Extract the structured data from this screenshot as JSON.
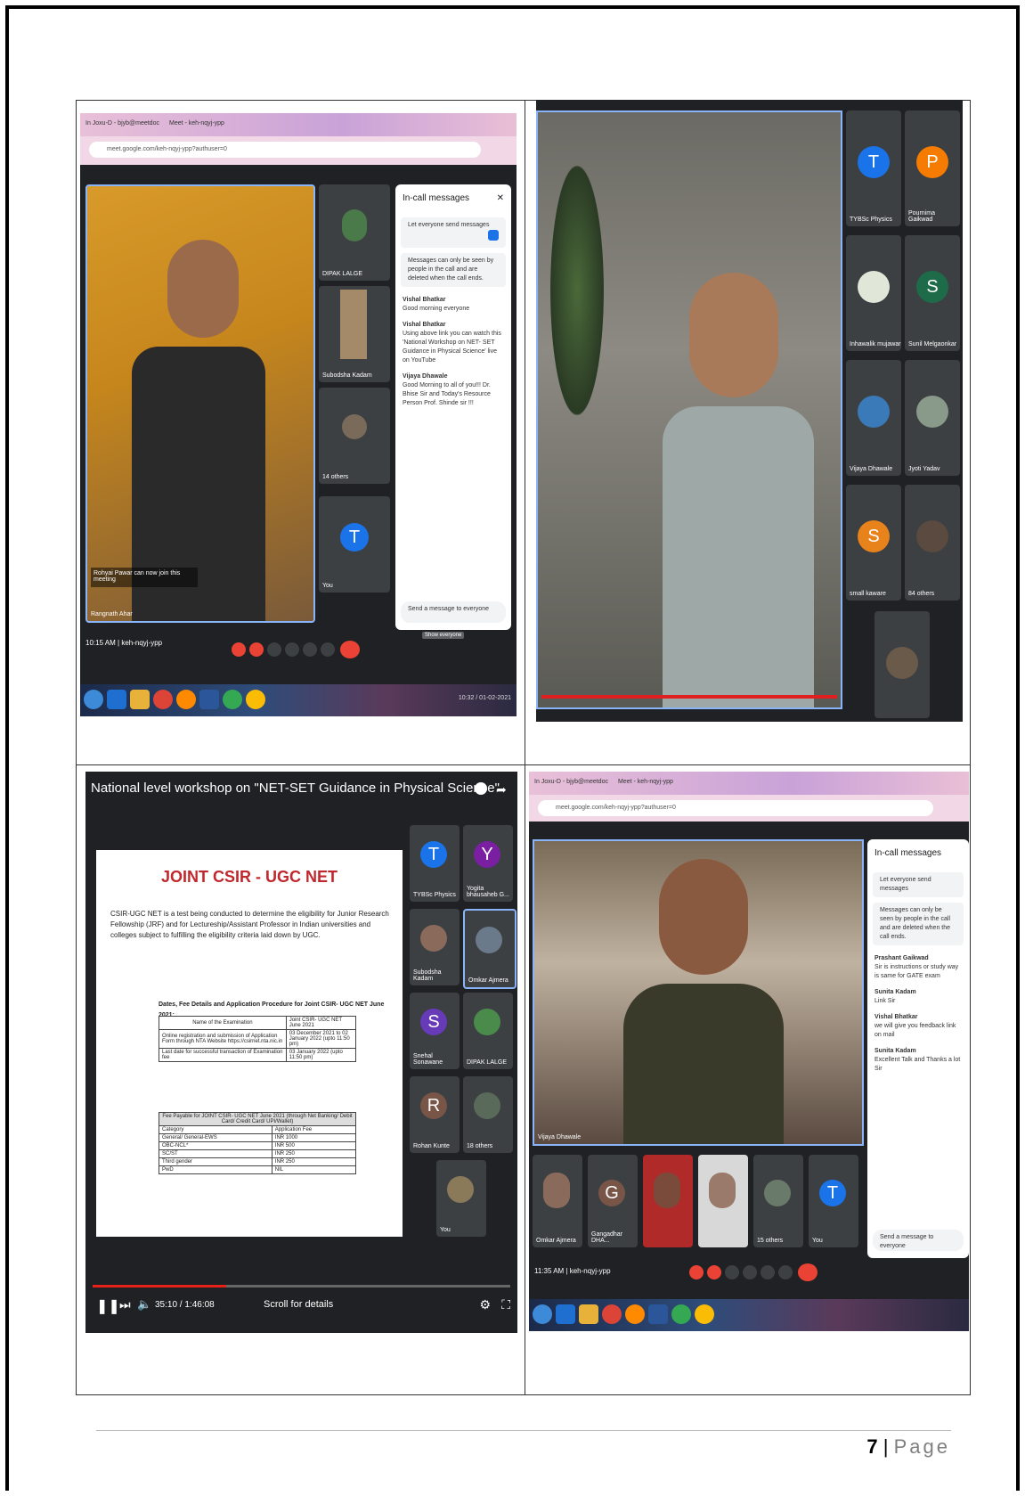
{
  "page": {
    "number": "7",
    "suffix": "Page"
  },
  "panel_tl": {
    "tabs": [
      "In Joxu-D - bjyb@meetdoc",
      "Meet - keh-nqyj-ypp"
    ],
    "url": "meet.google.com/keh-nqyj-ypp?authuser=0",
    "chat_title": "In-call messages",
    "chat_toggle": "Let everyone send messages",
    "chat_note": "Messages can only be seen by people in the call and are deleted when the call ends.",
    "messages": [
      {
        "from": "Vishal Bhatkar",
        "text": "Good morning everyone"
      },
      {
        "from": "Vishal Bhatkar",
        "text": "Using above link you can watch this 'National Workshop on NET- SET Guidance in Physical Science' live on YouTube"
      },
      {
        "from": "Vijaya Dhawale",
        "text": "Good Morning to all of you!!! Dr. Bhise Sir and Today's Resource Person Prof. Shinde sir !!!"
      }
    ],
    "chat_input": "Send a message to everyone",
    "tiles": [
      "DIPAK LALGE",
      "Subodsha Kadam",
      "14 others",
      "You"
    ],
    "notice": "Rohyai Pawar can now join this meeting",
    "speaker": "Rangnath Ahar",
    "time": "10:15 AM | keh-nqyj-ypp",
    "show_everyone": "Show everyone",
    "clock": "10:32 / 01-02-2021"
  },
  "panel_tr": {
    "tiles": [
      "TYBSc Physics",
      "Pournima Gaikwad",
      "Inhawalik mujawar",
      "Sunil Melgaonkar",
      "Vijaya Dhawale",
      "Jyoti Yadav",
      "small kaware",
      "84 others"
    ]
  },
  "panel_bl": {
    "yt_title": "National level workshop on \"NET-SET Guidance in Physical Science\"",
    "slide_title": "JOINT CSIR - UGC NET",
    "slide_text": "CSIR-UGC NET is a test being conducted to determine the eligibility for Junior Research Fellowship (JRF) and for Lectureship/Assistant Professor in Indian universities and colleges subject to fulfilling the eligibility criteria laid down by UGC.",
    "dates_heading": "Dates, Fee Details and Application Procedure for Joint CSIR- UGC NET June 2021:",
    "table1": [
      [
        "Name of the Examination",
        "Joint CSIR- UGC NET June 2021"
      ],
      [
        "Online registration and submission of Application Form through NTA Website https://csirnet.nta.nic.in",
        "03 December 2021 to 02 January 2022 (upto 11:50 pm)"
      ],
      [
        "Last date for successful transaction of Examination fee",
        "03 January 2022 (upto 11:50 pm)"
      ]
    ],
    "fee_heading": "Fee Payable for JOINT CSIR- UGC NET June 2021 (through Net Banking/ Debit Card/ Credit Card/ UPI/Wallet)",
    "table2": [
      [
        "Category",
        "Application Fee"
      ],
      [
        "General/ General-EWS",
        "INR 1000"
      ],
      [
        "OBC-NCL*",
        "INR 500"
      ],
      [
        "SC/ST",
        "INR 250"
      ],
      [
        "Third gender",
        "INR 250"
      ],
      [
        "PwD",
        "NIL"
      ]
    ],
    "tiles": [
      "TYBSc Physics",
      "Yogita bhausaheb G...",
      "Subodsha Kadam",
      "Omkar Ajmera",
      "Snehal Sonawane",
      "DIPAK LALGE",
      "Rohan Kunte",
      "18 others",
      "You"
    ],
    "time": "35:10 / 1:46:08",
    "scroll_hint": "Scroll for details"
  },
  "panel_br": {
    "tabs": [
      "In Joxu-D - bjyb@meetdoc",
      "Meet - keh-nqyj-ypp"
    ],
    "url": "meet.google.com/keh-nqyj-ypp?authuser=0",
    "chat_title": "In-call messages",
    "chat_toggle": "Let everyone send messages",
    "chat_note": "Messages can only be seen by people in the call and are deleted when the call ends.",
    "messages": [
      {
        "from": "Prashant Gaikwad",
        "text": "Sir is instructions or study way is same for GATE exam"
      },
      {
        "from": "Sunita Kadam",
        "text": "Link Sir"
      },
      {
        "from": "Vishal Bhatkar",
        "text": "we will give you feedback link on mail"
      },
      {
        "from": "Sunita Kadam",
        "text": "Excellent Talk and Thanks a lot Sir"
      }
    ],
    "chat_input": "Send a message to everyone",
    "speaker": "Vijaya Dhawale",
    "tiles": [
      "Omkar Ajmera",
      "Gangadhar DHA...",
      "",
      "",
      "15 others",
      "You"
    ],
    "time": "11:35 AM | keh-nqyj-ypp"
  }
}
